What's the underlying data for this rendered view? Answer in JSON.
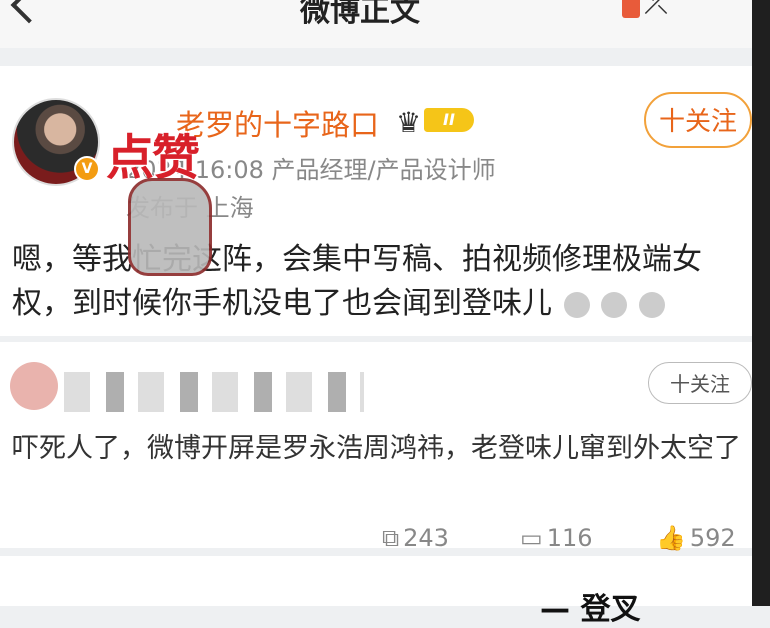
{
  "topbar": {
    "title": "微博正文",
    "share_glyph": "⤫",
    "more_glyph": "•••"
  },
  "post": {
    "username": "老罗的十字路口",
    "crown_glyph": "♛",
    "level_badge": "II",
    "follow_label": "十关注",
    "meta": "2024 16:08  产品经理/产品设计师",
    "location": "发布于 上海",
    "text": "嗯，等我忙完这阵，会集中写稿、拍视频修理极端女权，到时候你手机没电了也会闻到登味儿",
    "verified_glyph": "V"
  },
  "sticker": {
    "text": "点赞"
  },
  "comment": {
    "follow_label": "十关注",
    "text": "吓死人了，微博开屏是罗永浩周鸿祎，老登味儿窜到外太空了",
    "reposts": "243",
    "comments": "116",
    "likes": "592",
    "repost_glyph": "⧉",
    "comment_glyph": "▭",
    "like_glyph": "👍"
  },
  "bottom": {
    "partial_text": "—   登叉   "
  }
}
